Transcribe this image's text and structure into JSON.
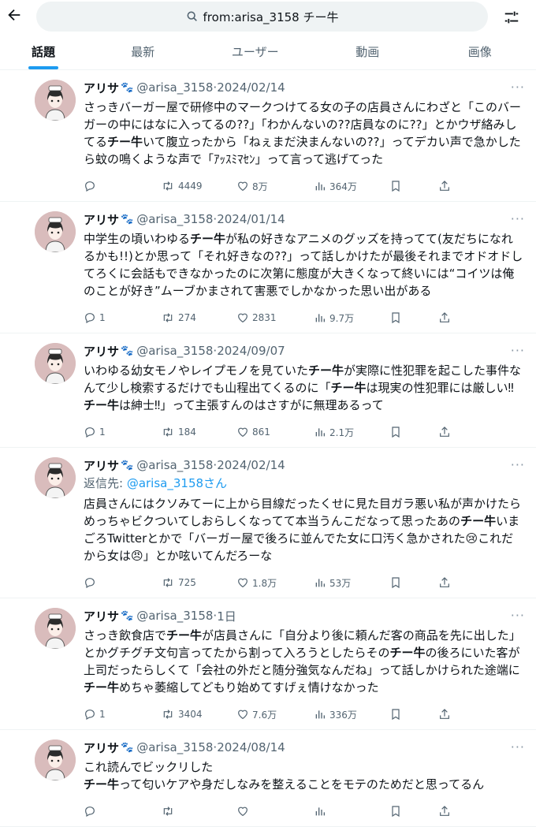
{
  "search": {
    "query": "from:arisa_3158 チー牛"
  },
  "tabs": [
    {
      "label": "話題",
      "active": true
    },
    {
      "label": "最新"
    },
    {
      "label": "ユーザー"
    },
    {
      "label": "動画"
    },
    {
      "label": "画像"
    }
  ],
  "colors": {
    "accent": "#1d9bf0",
    "secondary_text": "#536471",
    "avatar_bg": "#d9bcbc"
  },
  "tweets": [
    {
      "name": "アリサ",
      "handle": "@arisa_3158",
      "sep": "·",
      "date": "2024/02/14",
      "reply_to": "",
      "segments": [
        {
          "t": "さっきバーガー屋で研修中のマークつけてる女の子の店員さんにわざと「このバーガーの中にはなに入ってるの??」「わかんないの??店員なのに??」とかウザ絡みしてる"
        },
        {
          "t": "チー牛",
          "b": true
        },
        {
          "t": "いて腹立ったから「ねぇまだ決まんないの??」ってデカい声で急かしたら蚊の鳴くような声で「ｱｯｽﾐﾏｾﾝ」って言って逃げてった"
        }
      ],
      "replies": "",
      "retweets": "4449",
      "likes": "8万",
      "views": "364万"
    },
    {
      "name": "アリサ",
      "handle": "@arisa_3158",
      "sep": "·",
      "date": "2024/01/14",
      "reply_to": "",
      "segments": [
        {
          "t": "中学生の頃いわゆる"
        },
        {
          "t": "チー牛",
          "b": true
        },
        {
          "t": "が私の好きなアニメのグッズを持ってて(友だちになれるかも!!)とか思って「それ好きなの??」って話しかけたが最後それまでオドオドしてろくに会話もできなかったのに次第に態度が大きくなって終いには“コイツは俺のことが好き”ムーブかまされて害悪でしかなかった思い出がある"
        }
      ],
      "replies": "1",
      "retweets": "274",
      "likes": "2831",
      "views": "9.7万"
    },
    {
      "name": "アリサ",
      "handle": "@arisa_3158",
      "sep": "·",
      "date": "2024/09/07",
      "reply_to": "",
      "segments": [
        {
          "t": "いわゆる幼女モノやレイプモノを見ていた"
        },
        {
          "t": "チー牛",
          "b": true
        },
        {
          "t": "が実際に性犯罪を起こした事件なんて少し検索するだけでも山程出てくるのに「"
        },
        {
          "t": "チー牛",
          "b": true
        },
        {
          "t": "は現実の性犯罪には厳しい‼︎"
        },
        {
          "t": "チー牛",
          "b": true
        },
        {
          "t": "は紳士‼︎」って主張すんのはさすがに無理あるって"
        }
      ],
      "replies": "1",
      "retweets": "184",
      "likes": "861",
      "views": "2.1万"
    },
    {
      "name": "アリサ",
      "handle": "@arisa_3158",
      "sep": "·",
      "date": "2024/02/14",
      "reply_to_prefix": "返信先: ",
      "reply_to": "@arisa_3158さん",
      "segments": [
        {
          "t": "店員さんにはクソみてーに上から目線だったくせに見た目ガラ悪い私が声かけたらめっちゃビクついてしおらしくなってて本当うんこだなって思ったあの"
        },
        {
          "t": "チー牛",
          "b": true
        },
        {
          "t": "いまごろTwitterとかで「バーガー屋で後ろに並んでた女に口汚く急かされた😢これだから女は😠」とか呟いてんだろーな"
        }
      ],
      "replies": "",
      "retweets": "725",
      "likes": "1.8万",
      "views": "53万"
    },
    {
      "name": "アリサ",
      "handle": "@arisa_3158",
      "sep": "·",
      "date": "1日",
      "reply_to": "",
      "segments": [
        {
          "t": "さっき飲食店で"
        },
        {
          "t": "チー牛",
          "b": true
        },
        {
          "t": "が店員さんに「自分より後に頼んだ客の商品を先に出した」とかグチグチ文句言ってたから割って入ろうとしたらその"
        },
        {
          "t": "チー牛",
          "b": true
        },
        {
          "t": "の後ろにいた客が上司だったらしくて「会社の外だと随分強気なんだね」って話しかけられた途端に"
        },
        {
          "t": "チー牛",
          "b": true
        },
        {
          "t": "めちゃ萎縮してどもり始めてすげぇ情けなかった"
        }
      ],
      "replies": "1",
      "retweets": "3404",
      "likes": "7.6万",
      "views": "336万"
    },
    {
      "name": "アリサ",
      "handle": "@arisa_3158",
      "sep": "·",
      "date": "2024/08/14",
      "reply_to": "",
      "segments": [
        {
          "t": "これ読んでビックリした\n"
        },
        {
          "t": "チー牛",
          "b": true
        },
        {
          "t": "って匂いケアや身だしなみを整えることをモテのためだと思ってるん"
        }
      ],
      "replies": "",
      "retweets": "",
      "likes": "",
      "views": ""
    }
  ]
}
